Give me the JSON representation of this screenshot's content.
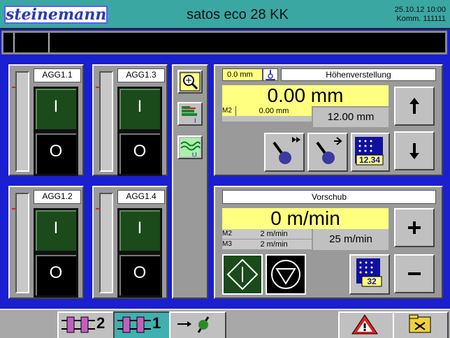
{
  "header": {
    "logo": "steinemann",
    "title": "satos eco 28 KK",
    "date": "25.10.12 10:00",
    "order": "Komm. 111111"
  },
  "aggregates": [
    {
      "label": "AGG1.1",
      "on": "I",
      "off": "O"
    },
    {
      "label": "AGG1.3",
      "on": "I",
      "off": "O"
    },
    {
      "label": "AGG1.2",
      "on": "I",
      "off": "O"
    },
    {
      "label": "AGG1.4",
      "on": "I",
      "off": "O"
    }
  ],
  "height": {
    "small_value": "0.0 mm",
    "title": "Höhenverstellung",
    "main_value": "0.00 mm",
    "m2_label": "M2",
    "m2_value": "0.00 mm",
    "target": "12.00 mm",
    "keypad_value": "12.34"
  },
  "feed": {
    "title": "Vorschub",
    "main_value": "0 m/min",
    "m2_label": "M2",
    "m2_value": "2 m/min",
    "m3_label": "M3",
    "m3_value": "2 m/min",
    "target": "25 m/min",
    "keypad_value": "32"
  },
  "footer": {
    "mode2": "2",
    "mode1": "1"
  },
  "colors": {
    "header": "#3aa7a3",
    "background": "#1a1fd0",
    "panel": "#9a9a9a",
    "display": "#ffff80",
    "switch_on": "#1b4a1b",
    "alarm": "#e02020"
  }
}
